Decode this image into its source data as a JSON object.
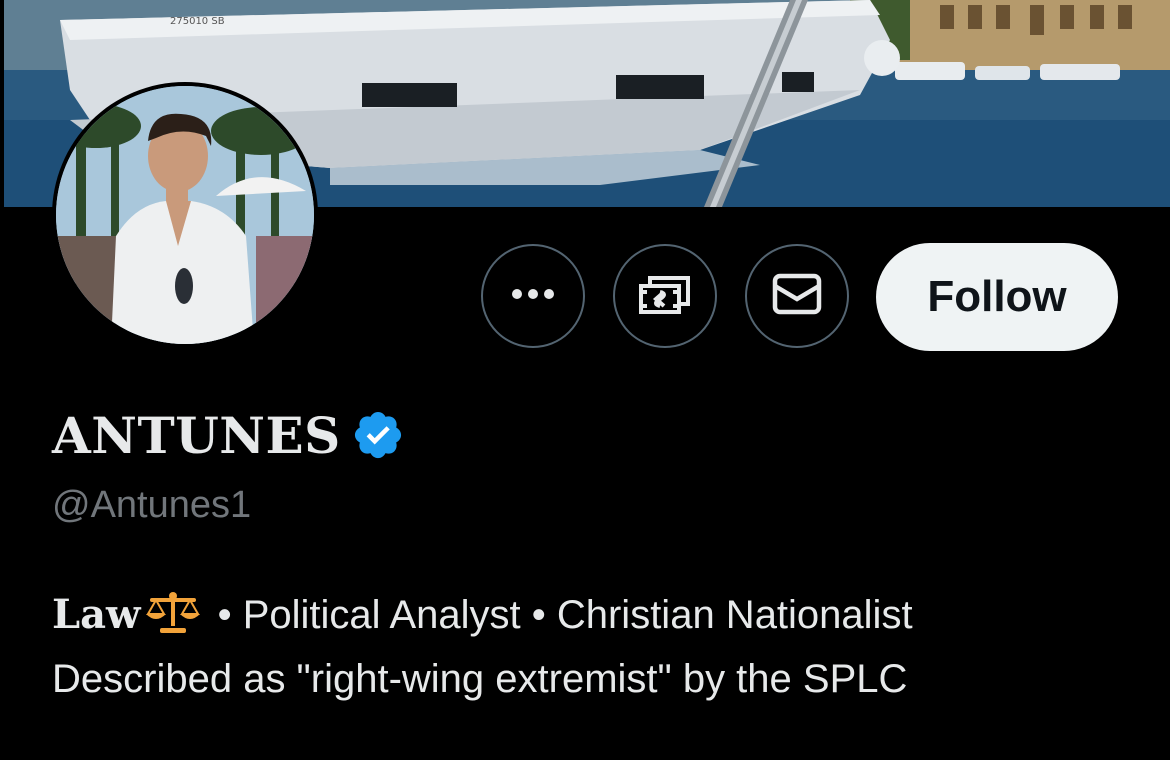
{
  "profile": {
    "display_name": "ANTUNES",
    "handle": "@Antunes1",
    "verified": true,
    "bio_law": "Law",
    "bio_line1_rest": " • Political Analyst • Christian Nationalist",
    "bio_line2": "Described as \"right-wing extremist\" by the SPLC",
    "banner_boat_text": "275010 SB"
  },
  "actions": {
    "more_icon": "more-horizontal-icon",
    "tip_icon": "money-icon",
    "message_icon": "envelope-icon",
    "follow_label": "Follow"
  },
  "colors": {
    "background": "#000000",
    "verified_blue": "#1d9bf0",
    "follow_bg": "#eff3f4",
    "handle_gray": "#71767b",
    "border_gray": "#536471"
  }
}
